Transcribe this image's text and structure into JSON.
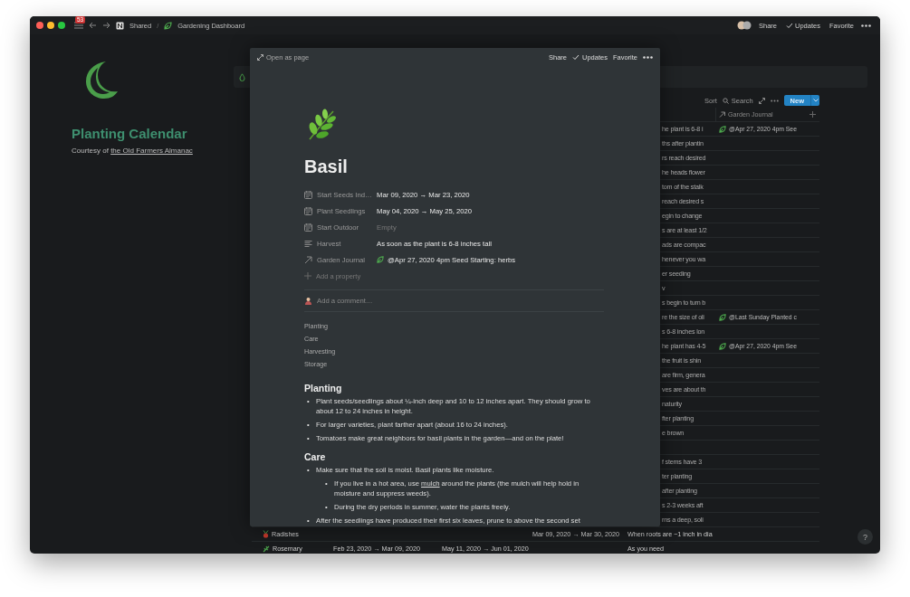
{
  "titlebar": {
    "notification_count": "53",
    "separator": "/",
    "help": "?",
    "breadcrumbs": [
      {
        "label": "Shared",
        "kind": "workspace"
      },
      {
        "label": "Gardening Dashboard",
        "kind": "page"
      }
    ],
    "actions": [
      "Share",
      "Updates",
      "Favorite"
    ]
  },
  "page": {
    "title": "Planting Calendar",
    "subtitle": "Courtesy of",
    "link": "the Old Farmers Almanac"
  },
  "toolbar": {
    "sort": "Sort",
    "search": "Search",
    "new_button": "New"
  },
  "table": {
    "header": "Garden Journal",
    "partial_rows": [
      {
        "column_5": "he plant is 6-8 i",
        "journal": "@Apr 27, 2020 4pm See"
      },
      {
        "column_5": "ths after plantin"
      },
      {
        "column_5": "rs reach desired"
      },
      {
        "column_5": "he heads flower"
      },
      {
        "column_5": "tom of the stalk"
      },
      {
        "column_5": "reach desired s"
      },
      {
        "column_5": "egin to change"
      },
      {
        "column_5": "s are at least 1/2"
      },
      {
        "column_5": "ads are compac"
      },
      {
        "column_5": "henever you wa"
      },
      {
        "column_5": "er seeding"
      },
      {
        "column_5": "v"
      },
      {
        "column_5": "s begin to turn b"
      },
      {
        "column_5": "re the size of oli",
        "journal": "@Last Sunday Planted c"
      },
      {
        "column_5": "s 6-8 inches lon"
      },
      {
        "column_5": "he plant has 4-5",
        "journal": "@Apr 27, 2020 4pm See"
      },
      {
        "column_5": "the fruit is shin"
      },
      {
        "column_5": "are firm, genera"
      },
      {
        "column_5": "ves are about th"
      },
      {
        "column_5": "naturity"
      },
      {
        "column_5": "fter planting"
      },
      {
        "column_5": "e brown"
      },
      {},
      {
        "column_5": "f stems have 3"
      },
      {
        "column_5": "ter planting"
      },
      {
        "column_5": "after planting"
      },
      {
        "column_5": "s 2-3 weeks aft"
      },
      {
        "column_5": "rns a deep, soli"
      }
    ],
    "rows": [
      {
        "name": "Radishes",
        "kind": "radish",
        "column_4": "Mar 09, 2020 → Mar 30, 2020",
        "column_5": "When roots are ~1 inch in dia"
      },
      {
        "name": "Rosemary",
        "kind": "sprig",
        "column_2": "Feb 23, 2020 → Mar 09, 2020",
        "column_3": "May 11, 2020 → Jun 01, 2020",
        "column_5": "As you need"
      }
    ]
  },
  "modal": {
    "open_as_page": "Open as page",
    "actions": [
      "Share",
      "Updates",
      "Favorite"
    ],
    "title": "Basil",
    "properties": [
      {
        "kind": "date",
        "label": "Start Seeds Ind…",
        "value": "Mar 09, 2020 → Mar 23, 2020",
        "empty": false
      },
      {
        "kind": "date",
        "label": "Plant Seedlings",
        "value": "May 04, 2020 → May 25, 2020",
        "empty": false
      },
      {
        "kind": "date",
        "label": "Start Outdoor",
        "value": "Empty",
        "empty": true
      },
      {
        "kind": "text",
        "label": "Harvest",
        "value": "As soon as the plant is 6-8 inches tall",
        "empty": false
      },
      {
        "kind": "relation",
        "label": "Garden Journal",
        "value": "@Apr 27, 2020 4pm Seed Starting: herbs",
        "empty": false
      }
    ],
    "bullet": "•",
    "add_property": "Add a property",
    "comment_placeholder": "Add a comment…",
    "toc": [
      "Planting",
      "Care",
      "Harvesting",
      "Storage"
    ],
    "sections": [
      {
        "heading": "Planting",
        "bullets": [
          {
            "text": "Plant seeds/seedlings about ¼-inch deep and 10 to 12 inches apart. They should grow to about 12 to 24 inches in height."
          },
          {
            "text": "For larger varieties, plant farther apart (about 16 to 24 inches)."
          },
          {
            "text": "Tomatoes make great neighbors for basil plants in the garden—and on the plate!"
          }
        ]
      },
      {
        "heading": "Care",
        "bullets": [
          {
            "text": "Make sure that the soil is moist. Basil plants like moisture.",
            "children": [
              {
                "text": "If you live in a hot area, use",
                "link": "mulch",
                "after": "around the plants (the mulch will help hold in moisture and suppress weeds)."
              },
              {
                "text": "During the dry periods in summer, water the plants freely."
              }
            ]
          },
          {
            "text": "After the seedlings have produced their first six leaves, prune to above the second set"
          }
        ]
      }
    ]
  }
}
